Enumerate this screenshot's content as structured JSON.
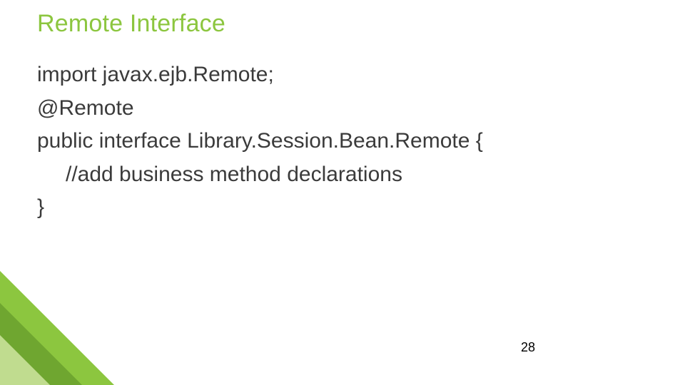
{
  "title": "Remote Interface",
  "code": {
    "line1": "import javax.ejb.Remote;",
    "line2": "@Remote",
    "line3": "public interface Library.Session.Bean.Remote {",
    "line4": "//add business method declarations",
    "line5": "}"
  },
  "page_number": "28"
}
